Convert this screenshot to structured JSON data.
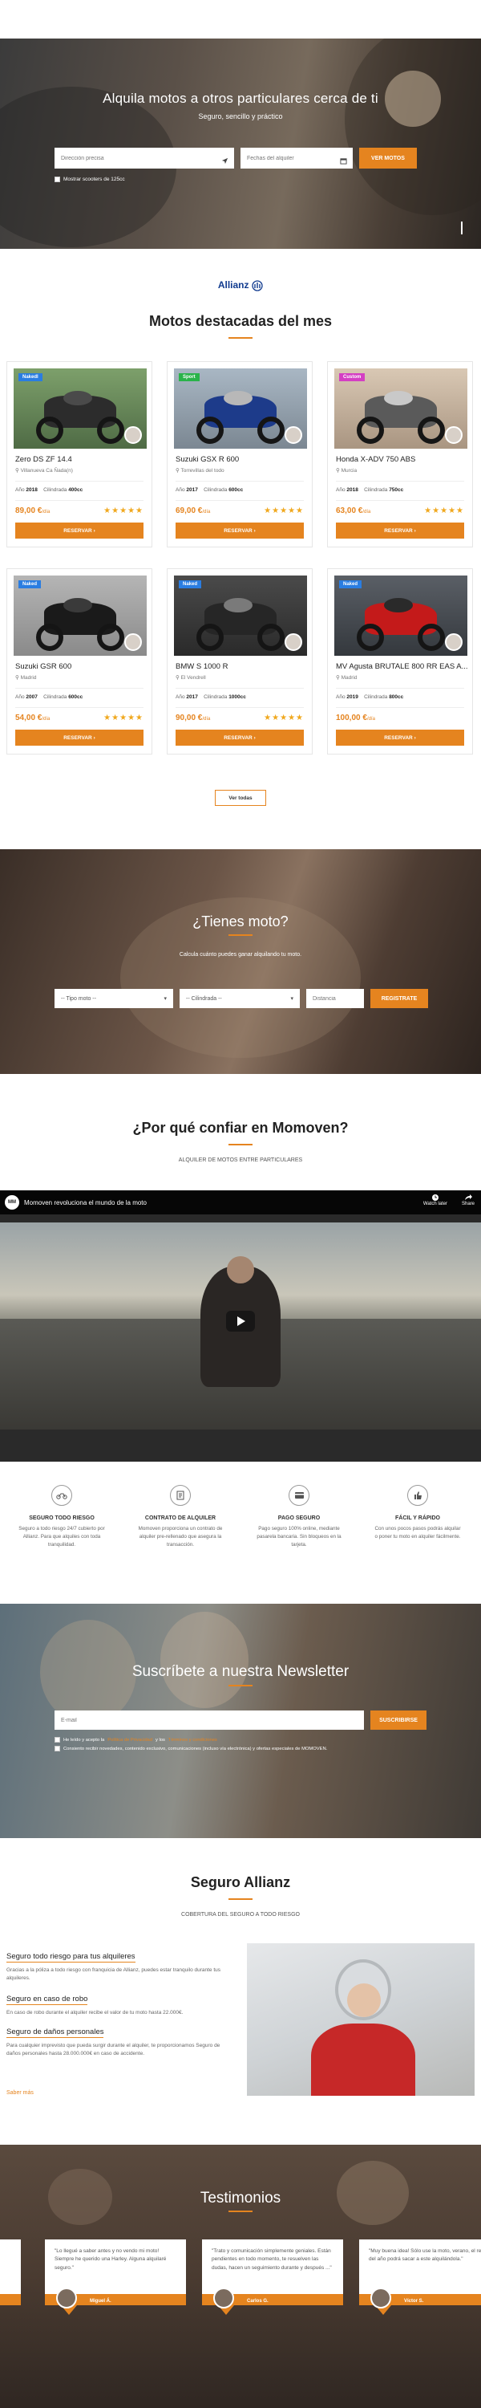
{
  "hero": {
    "title": "Alquila motos a otros particulares cerca de ti",
    "subtitle": "Seguro, sencillo y práctico",
    "location_placeholder": "Dirección precisa",
    "dates_placeholder": "Fechas del alquiler",
    "search_button": "Ver motos",
    "scooters_label": "Mostrar scooters de 125cc"
  },
  "partner": {
    "name": "Allianz"
  },
  "featured": {
    "title": "Motos destacadas del mes",
    "view_all": "Ver todas",
    "items": [
      {
        "badge": "Nakedl",
        "badge_color": "#2a7de1",
        "name": "Zero DS ZF 14.4",
        "location": "Villanueva Ca Ñada(n)",
        "year_label": "Año",
        "year": "2018",
        "cc_label": "Cilindrada",
        "cc": "400cc",
        "price": "89,00 €",
        "per": "/día",
        "stars": "★★★★★",
        "button": "Reservar"
      },
      {
        "badge": "Sport",
        "badge_color": "#2ab34a",
        "name": "Suzuki GSX R 600",
        "location": "Torrevillas del todo",
        "year_label": "Año",
        "year": "2017",
        "cc_label": "Cilindrada",
        "cc": "600cc",
        "price": "69,00 €",
        "per": "/día",
        "stars": "★★★★★",
        "button": "Reservar"
      },
      {
        "badge": "Custom",
        "badge_color": "#d43fc3",
        "name": "Honda X-ADV 750 ABS",
        "location": "Murcia",
        "year_label": "Año",
        "year": "2018",
        "cc_label": "Cilindrada",
        "cc": "750cc",
        "price": "63,00 €",
        "per": "/día",
        "stars": "★★★★★",
        "button": "Reservar"
      },
      {
        "badge": "Naked",
        "badge_color": "#2a7de1",
        "name": "Suzuki GSR 600",
        "location": "Madrid",
        "year_label": "Año",
        "year": "2007",
        "cc_label": "Cilindrada",
        "cc": "600cc",
        "price": "54,00 €",
        "per": "/día",
        "stars": "★★★★★",
        "button": "Reservar"
      },
      {
        "badge": "Naked",
        "badge_color": "#2a7de1",
        "name": "BMW S 1000 R",
        "location": "El Vendrell",
        "year_label": "Año",
        "year": "2017",
        "cc_label": "Cilindrada",
        "cc": "1000cc",
        "price": "90,00 €",
        "per": "/día",
        "stars": "★★★★★",
        "button": "Reservar"
      },
      {
        "badge": "Naked",
        "badge_color": "#2a7de1",
        "name": "MV Agusta BRUTALE 800 RR EAS A...",
        "location": "Madrid",
        "year_label": "Año",
        "year": "2019",
        "cc_label": "Cilindrada",
        "cc": "800cc",
        "price": "100,00 €",
        "per": "/día",
        "stars": "",
        "button": "Reservar"
      }
    ]
  },
  "owner": {
    "title": "¿Tienes moto?",
    "subtitle": "Calcula cuánto puedes ganar alquilando tu moto.",
    "type_select": "-- Tipo moto --",
    "cc_select": "-- Cilindrada --",
    "distance_placeholder": "Distancia",
    "button": "Registrate"
  },
  "trust": {
    "title": "¿Por qué confiar en Momoven?",
    "subtitle": "Alquiler de motos entre particulares",
    "video_title": "Momoven revoluciona el mundo de la moto",
    "watch_later": "Watch later",
    "share": "Share",
    "features": [
      {
        "icon": "motorbike-icon",
        "title": "Seguro todo riesgo",
        "text": "Seguro a todo riesgo 24/7 cubierto por Allianz. Para que alquiles con toda tranquilidad."
      },
      {
        "icon": "contract-icon",
        "title": "Contrato de alquiler",
        "text": "Momoven proporciona un contrato de alquiler pre-rellenado que asegura la transacción."
      },
      {
        "icon": "card-icon",
        "title": "Pago seguro",
        "text": "Pago seguro 100% online, mediante pasarela bancaria. Sin bloqueos en la tarjeta."
      },
      {
        "icon": "thumbs-up-icon",
        "title": "Fácil y rápido",
        "text": "Con unos pocos pasos podrás alquilar o poner tu moto en alquiler fácilmente."
      }
    ]
  },
  "newsletter": {
    "title": "Suscríbete a nuestra Newsletter",
    "email_placeholder": "E-mail",
    "button": "Suscribirse",
    "check1_a": "He leído y acepto la",
    "check1_link1": "Política de Privacidad",
    "check1_b": "y los",
    "check1_link2": "Términos y condiciones",
    "check2": "Consiento recibir novedades, contenido exclusivo, comunicaciones (incluso vía electrónica) y ofertas especiales de MOMOVEN."
  },
  "insurance": {
    "title": "Seguro Allianz",
    "subtitle": "Cobertura del seguro a todo riesgo",
    "blocks": [
      {
        "title": "Seguro todo riesgo para tus alquileres",
        "text": "Gracias a la póliza a todo riesgo con franquicia de Allianz, puedes estar tranquilo durante tus alquileres."
      },
      {
        "title": "Seguro en caso de robo",
        "text": "En caso de robo durante el alquiler recibe el valor de tu moto hasta 22.000€."
      },
      {
        "title": "Seguro de daños personales",
        "text": "Para cualquier imprevisto que pueda surgir durante el alquiler, te proporcionamos Seguro de daños personales hasta 28.000.000€ en caso de accidente."
      }
    ],
    "more": "Saber más"
  },
  "testimonials": {
    "title": "Testimonios",
    "items": [
      {
        "text": "\"Lo llegué a saber antes y no vendo mi moto! Siempre he querido una Harley. Alguna alquilaré seguro.\"",
        "name": "Miguel Á."
      },
      {
        "text": "\"Trato y comunicación simplemente geniales. Están pendientes en todo momento, te resuelven las dudas, hacen un seguimiento durante y después ...\"",
        "name": "Carlos G."
      },
      {
        "text": "\"Muy buena idea! Sólo use la moto, verano, el resto del año podrá sacar a este alquilándola.\"",
        "name": "Víctor S."
      }
    ]
  }
}
